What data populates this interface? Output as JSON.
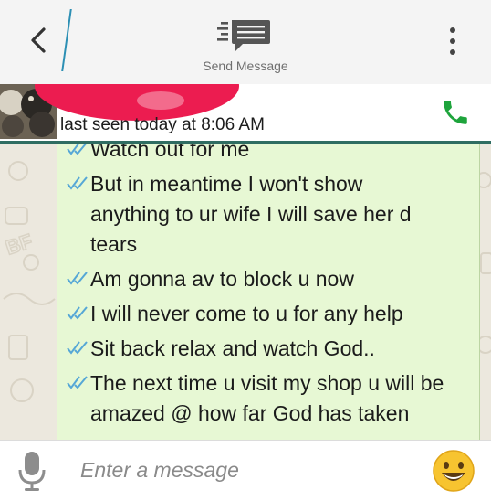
{
  "toolbar": {
    "send_label": "Send Message"
  },
  "contact": {
    "last_seen": "last seen today at 8:06 AM"
  },
  "messages": [
    {
      "lines": [
        "Watch out for me"
      ]
    },
    {
      "lines": [
        "But in meantime I won't show",
        "anything to ur wife I will save her d",
        "tears"
      ]
    },
    {
      "lines": [
        "Am gonna av to block u now"
      ]
    },
    {
      "lines": [
        "I will never come to u for any help"
      ]
    },
    {
      "lines": [
        "Sit back relax and watch God.."
      ]
    },
    {
      "lines": [
        "The next time u visit my shop u will be",
        "amazed @ how far God has taken"
      ]
    }
  ],
  "composer": {
    "placeholder": "Enter a message"
  },
  "colors": {
    "bubble": "#e7f8d4",
    "call": "#1ea43c",
    "accent": "#2c8fb4",
    "header_rule": "#2f6d62"
  },
  "icons": {
    "back": "chevron-left-icon",
    "send": "send-message-icon",
    "menu": "more-vert-icon",
    "call": "phone-icon",
    "mic": "microphone-icon",
    "emoji": "smiley-icon",
    "read": "double-check-icon"
  }
}
